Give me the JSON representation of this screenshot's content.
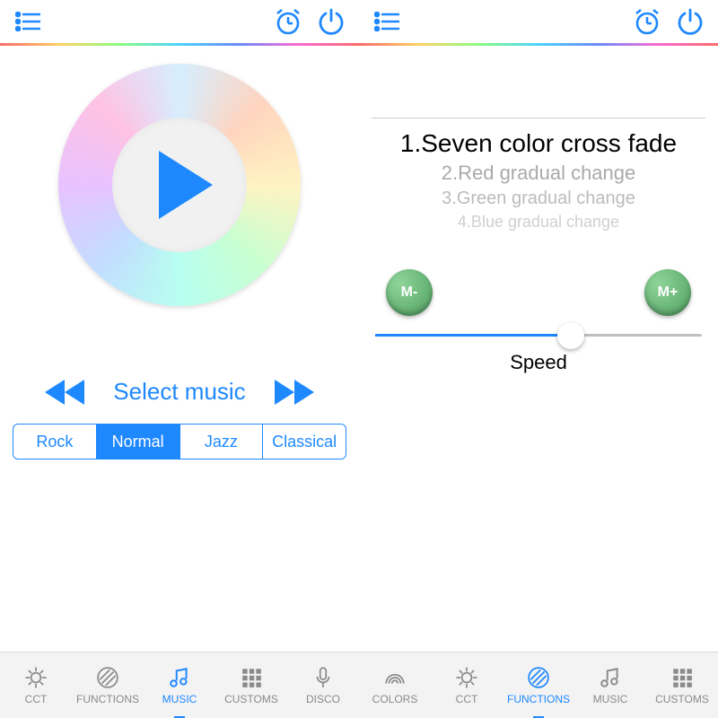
{
  "left": {
    "select_label": "Select music",
    "segments": [
      "Rock",
      "Normal",
      "Jazz",
      "Classical"
    ],
    "segment_active": 1,
    "tabs": [
      {
        "label": "CCT",
        "icon": "sun"
      },
      {
        "label": "FUNCTIONS",
        "icon": "stripes"
      },
      {
        "label": "MUSIC",
        "icon": "music"
      },
      {
        "label": "CUSTOMS",
        "icon": "grid"
      },
      {
        "label": "DISCO",
        "icon": "mic"
      }
    ],
    "tab_active": 2
  },
  "right": {
    "modes": [
      "1.Seven color cross fade",
      "2.Red gradual change",
      "3.Green gradual change",
      "4.Blue gradual change"
    ],
    "m_minus": "M-",
    "m_plus": "M+",
    "speed_label": "Speed",
    "slider_pct": 60,
    "tabs": [
      {
        "label": "COLORS",
        "icon": "rainbow"
      },
      {
        "label": "CCT",
        "icon": "sun"
      },
      {
        "label": "FUNCTIONS",
        "icon": "stripes"
      },
      {
        "label": "MUSIC",
        "icon": "music"
      },
      {
        "label": "CUSTOMS",
        "icon": "grid"
      }
    ],
    "tab_active": 2
  }
}
